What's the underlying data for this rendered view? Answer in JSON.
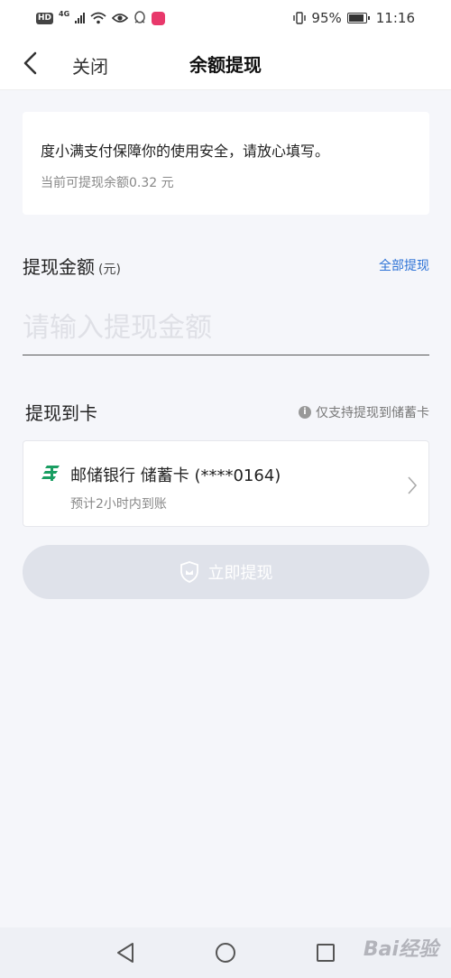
{
  "status_bar": {
    "hd_label": "HD",
    "network": "4G",
    "battery_percent": "95%",
    "time": "11:16"
  },
  "header": {
    "close_label": "关闭",
    "title": "余额提现"
  },
  "notice": {
    "message": "度小满支付保障你的使用安全，请放心填写。",
    "available_balance": "当前可提现余额0.32 元"
  },
  "amount": {
    "label": "提现金额",
    "unit": "(元)",
    "withdraw_all_label": "全部提现",
    "placeholder": "请输入提现金额",
    "value": ""
  },
  "card_section": {
    "label": "提现到卡",
    "hint": "仅支持提现到储蓄卡",
    "bank": {
      "name": "邮储银行 储蓄卡 (****0164)",
      "eta": "预计2小时内到账",
      "logo_color": "#1a9e62"
    }
  },
  "submit": {
    "label": "立即提现",
    "bg_color": "#dfe2ea"
  },
  "colors": {
    "accent": "#2e73d6",
    "background": "#f5f6fa"
  },
  "watermark": "Bai经验"
}
